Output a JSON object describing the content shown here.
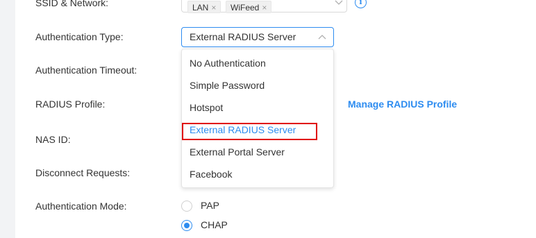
{
  "form": {
    "ssid_label": "SSID & Network",
    "auth_type_label": "Authentication Type",
    "auth_timeout_label": "Authentication Timeout",
    "radius_profile_label": "RADIUS Profile",
    "nas_id_label": "NAS ID",
    "disconnect_label": "Disconnect Requests",
    "auth_mode_label": "Authentication Mode",
    "label_suffix": ":"
  },
  "ssid": {
    "tags": [
      "LAN",
      "WiFeed"
    ],
    "tag_remove_glyph": "×",
    "info_glyph": "i"
  },
  "auth_type": {
    "selected": "External RADIUS Server",
    "options": [
      "No Authentication",
      "Simple Password",
      "Hotspot",
      "External RADIUS Server",
      "External Portal Server",
      "Facebook"
    ],
    "selected_index": 3
  },
  "radius": {
    "manage_link": "Manage RADIUS Profile"
  },
  "auth_mode": {
    "options": [
      "PAP",
      "CHAP"
    ],
    "selected": "CHAP"
  },
  "colors": {
    "accent": "#2d8cf0",
    "highlight": "#e00000"
  },
  "icons": {
    "chevron_down": "chevron-down-icon",
    "chevron_up": "chevron-up-icon",
    "info": "info-icon",
    "tag_close": "close-icon"
  }
}
